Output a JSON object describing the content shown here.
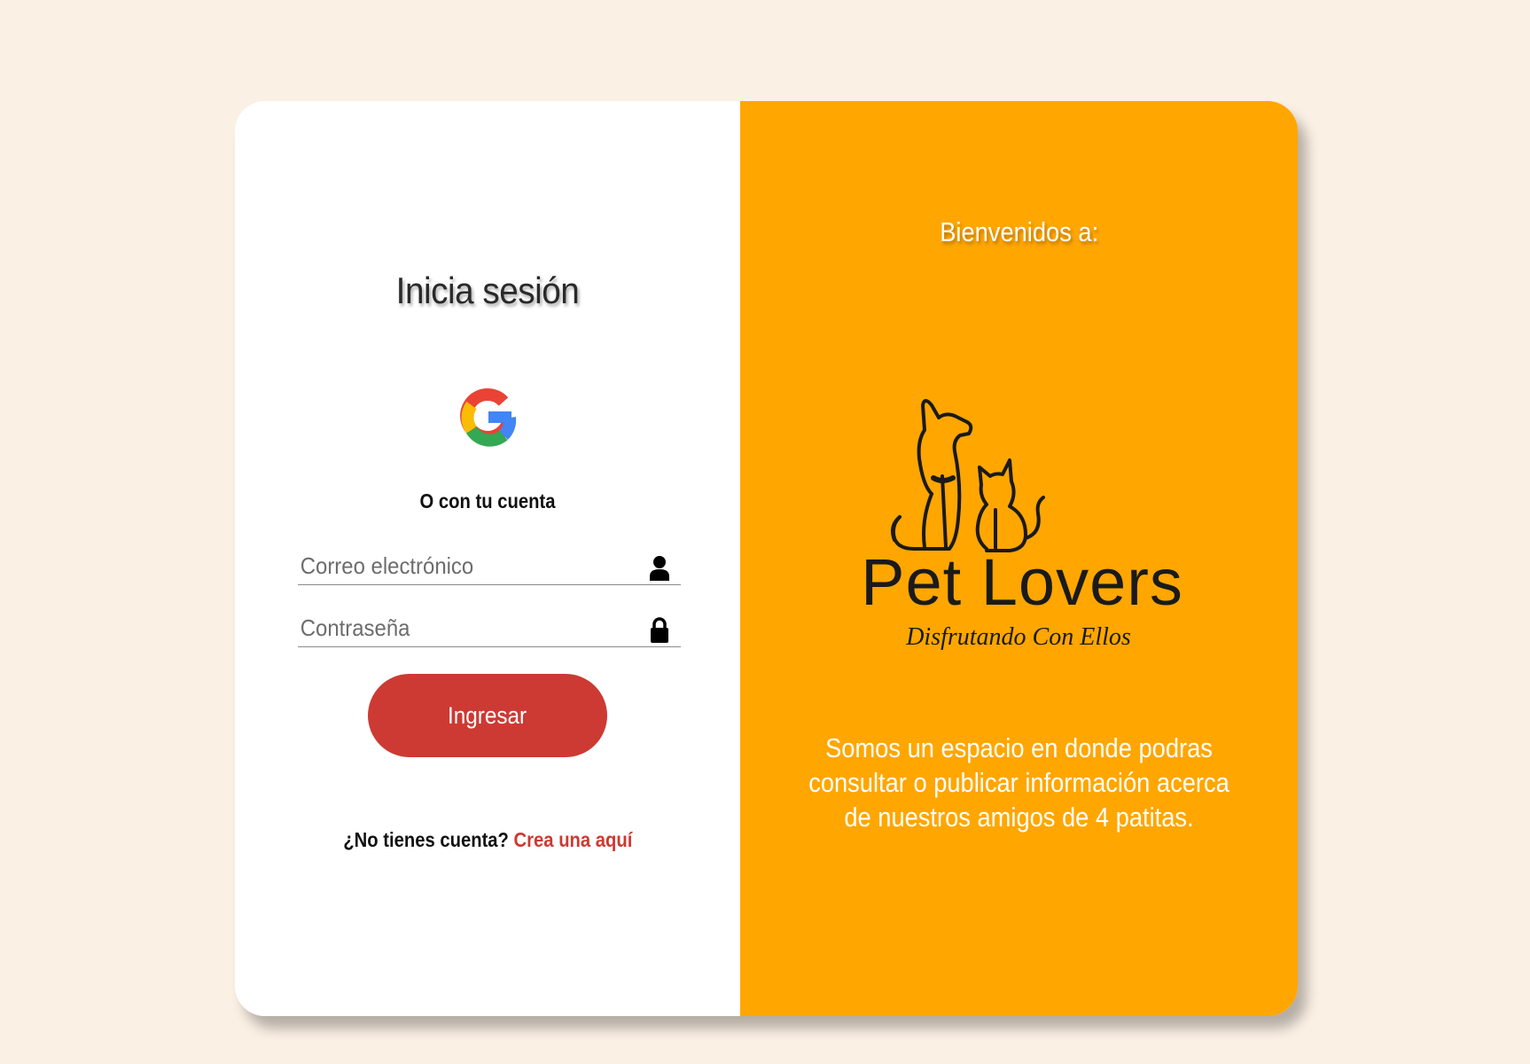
{
  "login": {
    "title": "Inicia sesión",
    "alt_login_text": "O con tu cuenta",
    "email_placeholder": "Correo electrónico",
    "password_placeholder": "Contraseña",
    "submit_label": "Ingresar",
    "no_account_text": "¿No tienes cuenta?",
    "signup_link": "Crea una aquí"
  },
  "welcome": {
    "greeting": "Bienvenidos a:",
    "brand_name": "Pet Lovers",
    "brand_tagline": "Disfrutando Con Ellos",
    "description": "Somos un espacio en donde podras consultar o publicar información acerca de nuestros amigos de 4 patitas."
  },
  "icons": {
    "google": "google-icon",
    "email": "user-icon",
    "password": "lock-icon",
    "logo": "dog-cat-icon"
  },
  "colors": {
    "background": "#fbf0e4",
    "panel_accent": "#ffa600",
    "button": "#cc3a33",
    "link": "#cc3a33"
  }
}
